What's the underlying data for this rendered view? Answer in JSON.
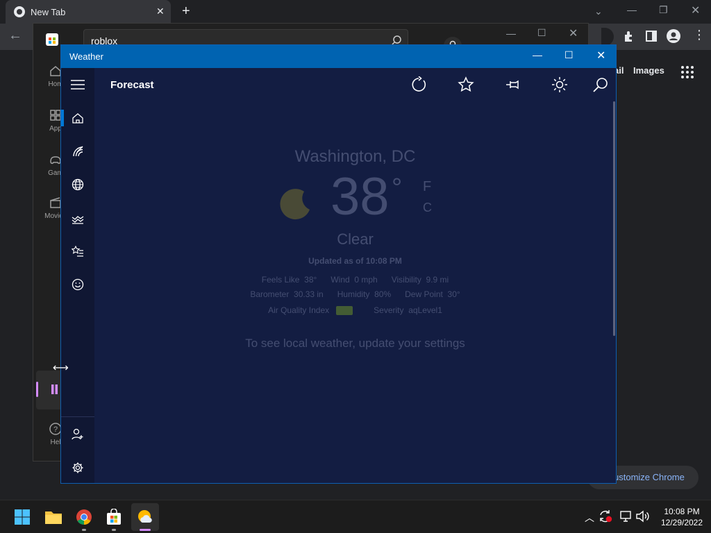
{
  "chrome": {
    "tab_title": "New Tab",
    "right_links": [
      "ail",
      "Images"
    ],
    "customize_label": "ustomize Chrome"
  },
  "store": {
    "search_value": "roblox",
    "nav": [
      "Hom",
      "App",
      "Gam",
      "Movies",
      "Hel"
    ]
  },
  "weather": {
    "window_title": "Weather",
    "page_title": "Forecast",
    "location": "Washington, DC",
    "temperature": "38",
    "degree_symbol": "°",
    "unit_f": "F",
    "unit_c": "C",
    "condition": "Clear",
    "updated": "Updated as of 10:08 PM",
    "details_row1": [
      {
        "label": "Feels Like",
        "value": "38°"
      },
      {
        "label": "Wind",
        "value": "0 mph"
      },
      {
        "label": "Visibility",
        "value": "9.9 mi"
      }
    ],
    "details_row2": [
      {
        "label": "Barometer",
        "value": "30.33 in"
      },
      {
        "label": "Humidity",
        "value": "80%"
      },
      {
        "label": "Dew Point",
        "value": "30°"
      }
    ],
    "aqi_label": "Air Quality Index",
    "severity_label": "Severity",
    "severity_value": "aqLevel1",
    "aqi_color": "#6b8f2a",
    "notice": "To see local weather, update your settings",
    "accent": "#0063b1",
    "background": "#131d42"
  },
  "taskbar": {
    "time": "10:08 PM",
    "date": "12/29/2022"
  }
}
